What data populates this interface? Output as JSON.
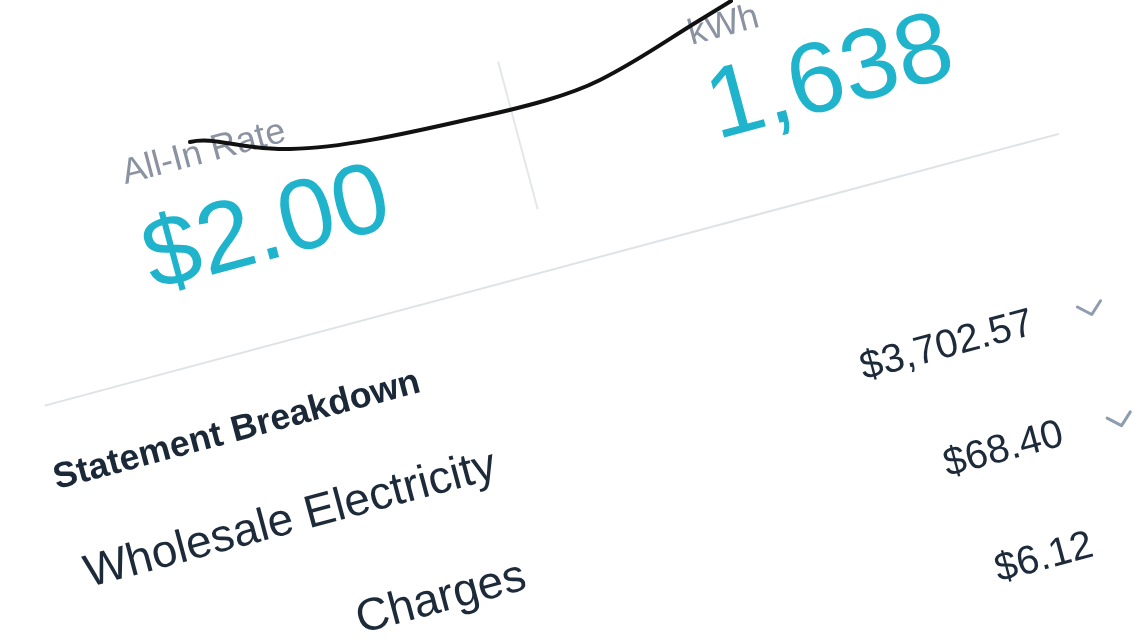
{
  "stats": [
    {
      "label": "All-In Rate",
      "value": "$2.00"
    },
    {
      "label": "kWh",
      "value": "1,638"
    }
  ],
  "statement_breakdown": {
    "title": "Statement Breakdown",
    "rows": [
      {
        "label": "Wholesale Electricity",
        "amount": "$3,702.57",
        "expanded": false
      },
      {
        "label": "Charges",
        "amount": "$68.40",
        "expanded": false
      },
      {
        "amount": "$6.12"
      }
    ]
  }
}
